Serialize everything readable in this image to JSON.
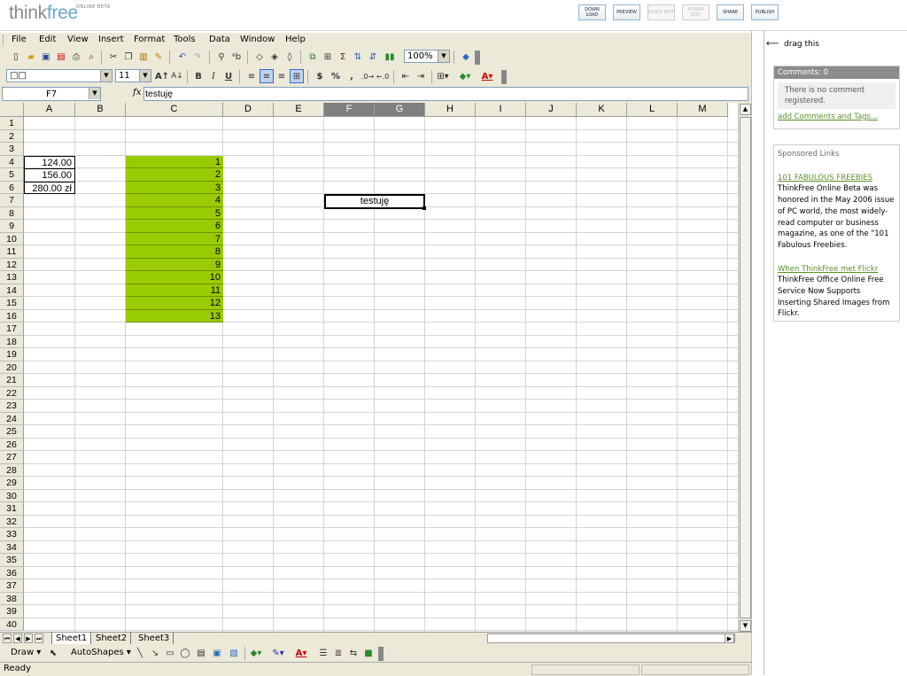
{
  "brand": {
    "name_a": "think",
    "name_b": "free",
    "tag": "ONLINE BETA"
  },
  "top_buttons": [
    {
      "label": "DOWN LOAD",
      "enabled": true
    },
    {
      "label": "PREVIEW",
      "enabled": true
    },
    {
      "label": "QUICK EDIT",
      "enabled": false
    },
    {
      "label": "POWER EDIT",
      "enabled": false
    },
    {
      "label": "SHARE",
      "enabled": true
    },
    {
      "label": "PUBLISH",
      "enabled": true
    }
  ],
  "menu": [
    "File",
    "Edit",
    "View",
    "Insert",
    "Format",
    "Tools",
    "Data",
    "Window",
    "Help"
  ],
  "toolbar": {
    "zoom": "100%",
    "font_name": "□□",
    "font_size": "11",
    "bold": "B",
    "italic": "I",
    "underline": "U",
    "currency": "$",
    "percent": "%",
    "comma": ","
  },
  "formula_bar": {
    "cell_ref": "F7",
    "fx": "fx",
    "value": "testuję"
  },
  "columns": [
    "A",
    "B",
    "C",
    "D",
    "E",
    "F",
    "G",
    "H",
    "I",
    "J",
    "K",
    "L",
    "M"
  ],
  "selected_columns": [
    "F",
    "G"
  ],
  "rows": [
    "1",
    "2",
    "3",
    "4",
    "5",
    "6",
    "7",
    "8",
    "9",
    "10",
    "11",
    "12",
    "13",
    "14",
    "15",
    "16",
    "17",
    "18",
    "19",
    "20",
    "21",
    "22",
    "23",
    "24",
    "25",
    "26",
    "27",
    "28",
    "29",
    "30",
    "31",
    "32",
    "33",
    "34",
    "35",
    "36",
    "37",
    "38",
    "39",
    "40"
  ],
  "cells": {
    "A4": "124.00",
    "A5": "156.00",
    "A6": "280.00  zł",
    "F7": "testuję",
    "C": [
      "1",
      "2",
      "3",
      "4",
      "5",
      "6",
      "7",
      "8",
      "9",
      "10",
      "11",
      "12",
      "13"
    ]
  },
  "fill_color": "#99cc00",
  "sheet_tabs": [
    "Sheet1",
    "Sheet2",
    "Sheet3"
  ],
  "active_sheet": "Sheet1",
  "draw_toolbar": {
    "draw": "Draw",
    "autoshapes": "AutoShapes"
  },
  "status": "Ready",
  "side": {
    "drag": "drag this",
    "comments_header": "Comments: 0",
    "no_comment": "There is no comment registered.",
    "add_link": "add Comments and Tags...",
    "sponsored_title": "Sponsored Links",
    "ads": [
      {
        "title": "101 FABULOUS FREEBIES",
        "text": "ThinkFree Online Beta was honored in the May 2006 issue of PC world, the most widely-read computer or business magazine, as one of the \"101 Fabulous Freebies."
      },
      {
        "title": "When ThinkFree met Flickr",
        "text": "ThinkFree Office Online Free Service Now Supports Inserting Shared Images from Flickr."
      }
    ]
  }
}
